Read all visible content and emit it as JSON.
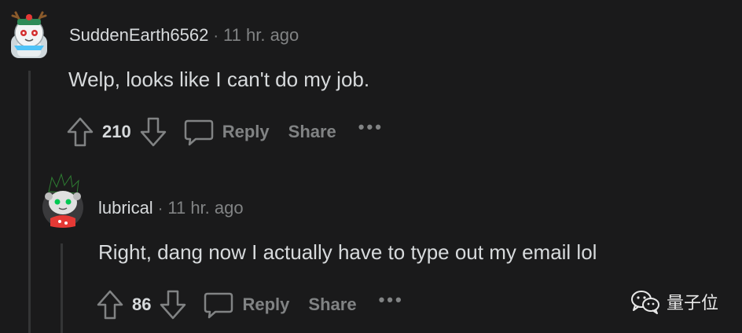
{
  "comments": [
    {
      "username": "SuddenEarth6562",
      "separator": "·",
      "time": "11 hr. ago",
      "text": "Welp, looks like I can't do my job.",
      "votes": "210",
      "reply_label": "Reply",
      "share_label": "Share",
      "more_label": "•••"
    },
    {
      "username": "lubrical",
      "separator": "·",
      "time": "11 hr. ago",
      "text": "Right, dang now I actually have to type out my email lol",
      "votes": "86",
      "reply_label": "Reply",
      "share_label": "Share",
      "more_label": "•••"
    }
  ],
  "watermark": {
    "text": "量子位",
    "icon": "wechat-icon"
  },
  "colors": {
    "background": "#1a1a1b",
    "text": "#d7dadc",
    "muted": "#818384",
    "thread_line": "#343536"
  }
}
